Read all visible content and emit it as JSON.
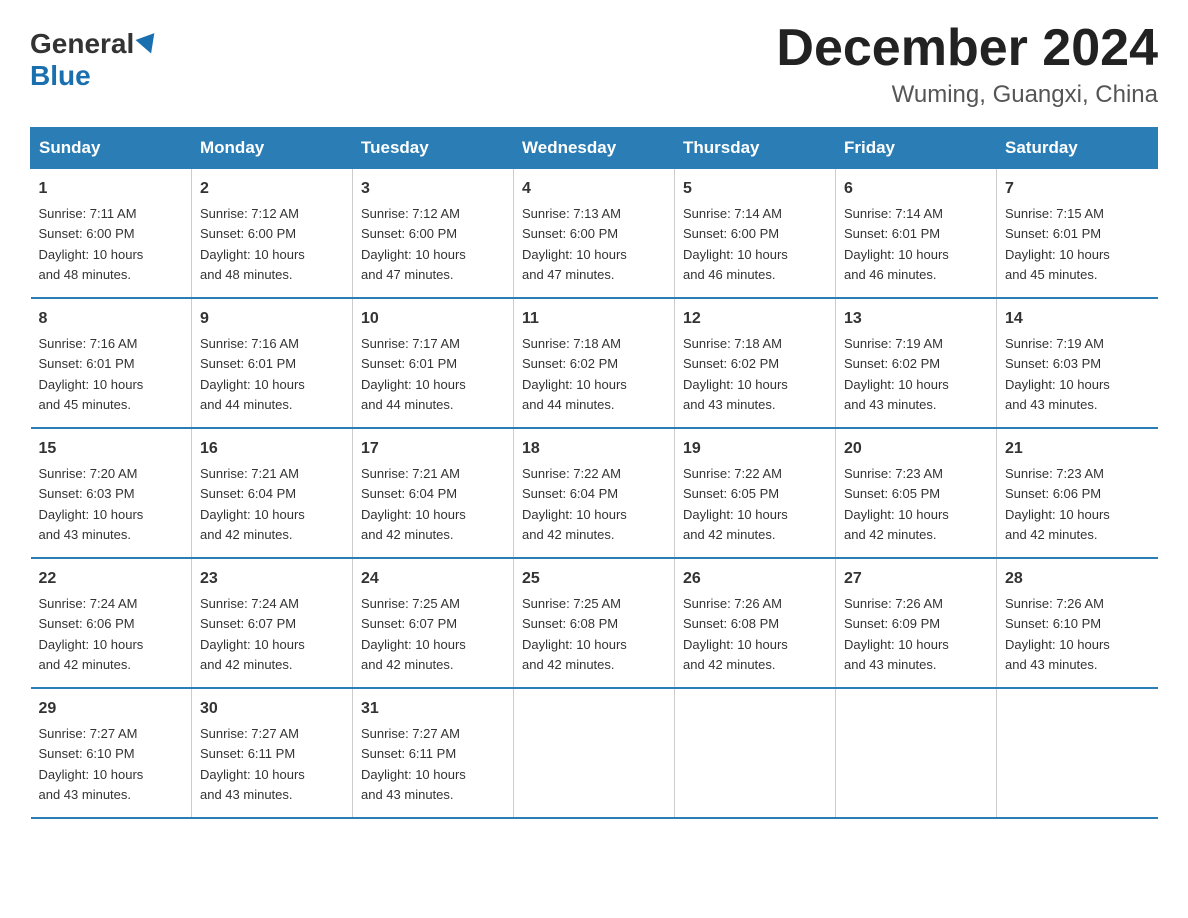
{
  "logo": {
    "general": "General",
    "blue": "Blue",
    "triangle_color": "#1a6faf"
  },
  "header": {
    "month_year": "December 2024",
    "location": "Wuming, Guangxi, China"
  },
  "weekdays": [
    "Sunday",
    "Monday",
    "Tuesday",
    "Wednesday",
    "Thursday",
    "Friday",
    "Saturday"
  ],
  "weeks": [
    [
      {
        "day": "1",
        "sunrise": "7:11 AM",
        "sunset": "6:00 PM",
        "daylight": "10 hours and 48 minutes."
      },
      {
        "day": "2",
        "sunrise": "7:12 AM",
        "sunset": "6:00 PM",
        "daylight": "10 hours and 48 minutes."
      },
      {
        "day": "3",
        "sunrise": "7:12 AM",
        "sunset": "6:00 PM",
        "daylight": "10 hours and 47 minutes."
      },
      {
        "day": "4",
        "sunrise": "7:13 AM",
        "sunset": "6:00 PM",
        "daylight": "10 hours and 47 minutes."
      },
      {
        "day": "5",
        "sunrise": "7:14 AM",
        "sunset": "6:00 PM",
        "daylight": "10 hours and 46 minutes."
      },
      {
        "day": "6",
        "sunrise": "7:14 AM",
        "sunset": "6:01 PM",
        "daylight": "10 hours and 46 minutes."
      },
      {
        "day": "7",
        "sunrise": "7:15 AM",
        "sunset": "6:01 PM",
        "daylight": "10 hours and 45 minutes."
      }
    ],
    [
      {
        "day": "8",
        "sunrise": "7:16 AM",
        "sunset": "6:01 PM",
        "daylight": "10 hours and 45 minutes."
      },
      {
        "day": "9",
        "sunrise": "7:16 AM",
        "sunset": "6:01 PM",
        "daylight": "10 hours and 44 minutes."
      },
      {
        "day": "10",
        "sunrise": "7:17 AM",
        "sunset": "6:01 PM",
        "daylight": "10 hours and 44 minutes."
      },
      {
        "day": "11",
        "sunrise": "7:18 AM",
        "sunset": "6:02 PM",
        "daylight": "10 hours and 44 minutes."
      },
      {
        "day": "12",
        "sunrise": "7:18 AM",
        "sunset": "6:02 PM",
        "daylight": "10 hours and 43 minutes."
      },
      {
        "day": "13",
        "sunrise": "7:19 AM",
        "sunset": "6:02 PM",
        "daylight": "10 hours and 43 minutes."
      },
      {
        "day": "14",
        "sunrise": "7:19 AM",
        "sunset": "6:03 PM",
        "daylight": "10 hours and 43 minutes."
      }
    ],
    [
      {
        "day": "15",
        "sunrise": "7:20 AM",
        "sunset": "6:03 PM",
        "daylight": "10 hours and 43 minutes."
      },
      {
        "day": "16",
        "sunrise": "7:21 AM",
        "sunset": "6:04 PM",
        "daylight": "10 hours and 42 minutes."
      },
      {
        "day": "17",
        "sunrise": "7:21 AM",
        "sunset": "6:04 PM",
        "daylight": "10 hours and 42 minutes."
      },
      {
        "day": "18",
        "sunrise": "7:22 AM",
        "sunset": "6:04 PM",
        "daylight": "10 hours and 42 minutes."
      },
      {
        "day": "19",
        "sunrise": "7:22 AM",
        "sunset": "6:05 PM",
        "daylight": "10 hours and 42 minutes."
      },
      {
        "day": "20",
        "sunrise": "7:23 AM",
        "sunset": "6:05 PM",
        "daylight": "10 hours and 42 minutes."
      },
      {
        "day": "21",
        "sunrise": "7:23 AM",
        "sunset": "6:06 PM",
        "daylight": "10 hours and 42 minutes."
      }
    ],
    [
      {
        "day": "22",
        "sunrise": "7:24 AM",
        "sunset": "6:06 PM",
        "daylight": "10 hours and 42 minutes."
      },
      {
        "day": "23",
        "sunrise": "7:24 AM",
        "sunset": "6:07 PM",
        "daylight": "10 hours and 42 minutes."
      },
      {
        "day": "24",
        "sunrise": "7:25 AM",
        "sunset": "6:07 PM",
        "daylight": "10 hours and 42 minutes."
      },
      {
        "day": "25",
        "sunrise": "7:25 AM",
        "sunset": "6:08 PM",
        "daylight": "10 hours and 42 minutes."
      },
      {
        "day": "26",
        "sunrise": "7:26 AM",
        "sunset": "6:08 PM",
        "daylight": "10 hours and 42 minutes."
      },
      {
        "day": "27",
        "sunrise": "7:26 AM",
        "sunset": "6:09 PM",
        "daylight": "10 hours and 43 minutes."
      },
      {
        "day": "28",
        "sunrise": "7:26 AM",
        "sunset": "6:10 PM",
        "daylight": "10 hours and 43 minutes."
      }
    ],
    [
      {
        "day": "29",
        "sunrise": "7:27 AM",
        "sunset": "6:10 PM",
        "daylight": "10 hours and 43 minutes."
      },
      {
        "day": "30",
        "sunrise": "7:27 AM",
        "sunset": "6:11 PM",
        "daylight": "10 hours and 43 minutes."
      },
      {
        "day": "31",
        "sunrise": "7:27 AM",
        "sunset": "6:11 PM",
        "daylight": "10 hours and 43 minutes."
      },
      null,
      null,
      null,
      null
    ]
  ],
  "labels": {
    "sunrise": "Sunrise:",
    "sunset": "Sunset:",
    "daylight": "Daylight:"
  }
}
